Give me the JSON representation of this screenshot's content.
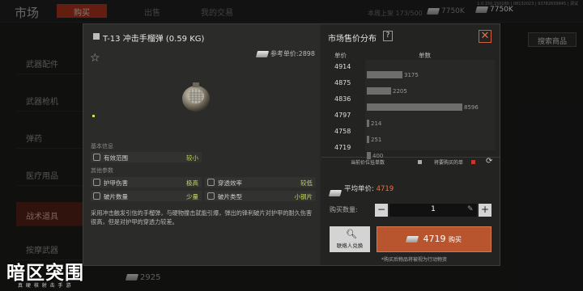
{
  "background": {
    "page_title": "市场",
    "tabs": [
      "购买",
      "出售",
      "我的交易"
    ],
    "weekly_cap": "本周上架 173/500",
    "money": "7750K",
    "version": "1.0.150.150180 | 08132023 | 93782659845 | 调试",
    "balance": "7750K",
    "sidebar": [
      "武器配件",
      "武器枪机",
      "弹药",
      "医疗用品",
      "战术道具",
      "按摩武器"
    ],
    "search_label": "搜索商品",
    "visible_price": "2925"
  },
  "logo": {
    "main": "暗区突围",
    "sub": "真 硬 核 射 击 手 游"
  },
  "item": {
    "name": "T-13 冲击手榴弹 (0.59 KG)",
    "ref_price": "参考单价:2898",
    "basic_info_label": "基本信息",
    "other_params_label": "其他参数",
    "attrs": [
      {
        "label": "有效范围",
        "value": "较小"
      },
      {
        "label": "护甲伤害",
        "value": "极高"
      },
      {
        "label": "穿透效率",
        "value": "较低"
      },
      {
        "label": "破片数量",
        "value": "少量"
      },
      {
        "label": "破片类型",
        "value": "小钢片"
      }
    ],
    "description": "采用冲击触发引信的手榴弹，与硬物撞击就能引爆，弹出的锋利破片对护甲的耐久伤害很高，但是对护甲的穿透力较差。"
  },
  "market": {
    "title": "市场售价分布",
    "help": "?",
    "col_unit": "单价",
    "col_qty": "单数",
    "legend_mine": "当前价位挂单数",
    "legend_buy": "将要购买的单",
    "avg_label": "平均单价:",
    "avg_value": "4719",
    "qty_label": "购买数量:",
    "qty_value": "1",
    "contact_label": "联络人兑换",
    "buy_price": "4719",
    "buy_label": "购买",
    "note": "*购买后物品将被视为行动物资"
  },
  "chart_data": {
    "type": "bar",
    "orientation": "horizontal",
    "categories": [
      "4914",
      "4875",
      "4836",
      "4797",
      "4758",
      "4719"
    ],
    "series": [
      {
        "values": [
          0,
          3175,
          2205,
          8596,
          214,
          251,
          400
        ]
      }
    ],
    "bar_rows": [
      {
        "price_after": "4914",
        "value": 3175
      },
      {
        "price_after": "4875",
        "value": 2205
      },
      {
        "price_after": "4836",
        "value": 8596
      },
      {
        "price_after": "4797",
        "value": 214
      },
      {
        "price_after": "4758",
        "value": 251
      },
      {
        "price_after": "4719",
        "value": 400
      }
    ],
    "xlabel": "单数",
    "ylabel": "单价",
    "xlim": [
      0,
      8596
    ]
  },
  "colors": {
    "accent": "#b8552e",
    "highlight": "#c8d85a",
    "avg": "#e8734a"
  }
}
